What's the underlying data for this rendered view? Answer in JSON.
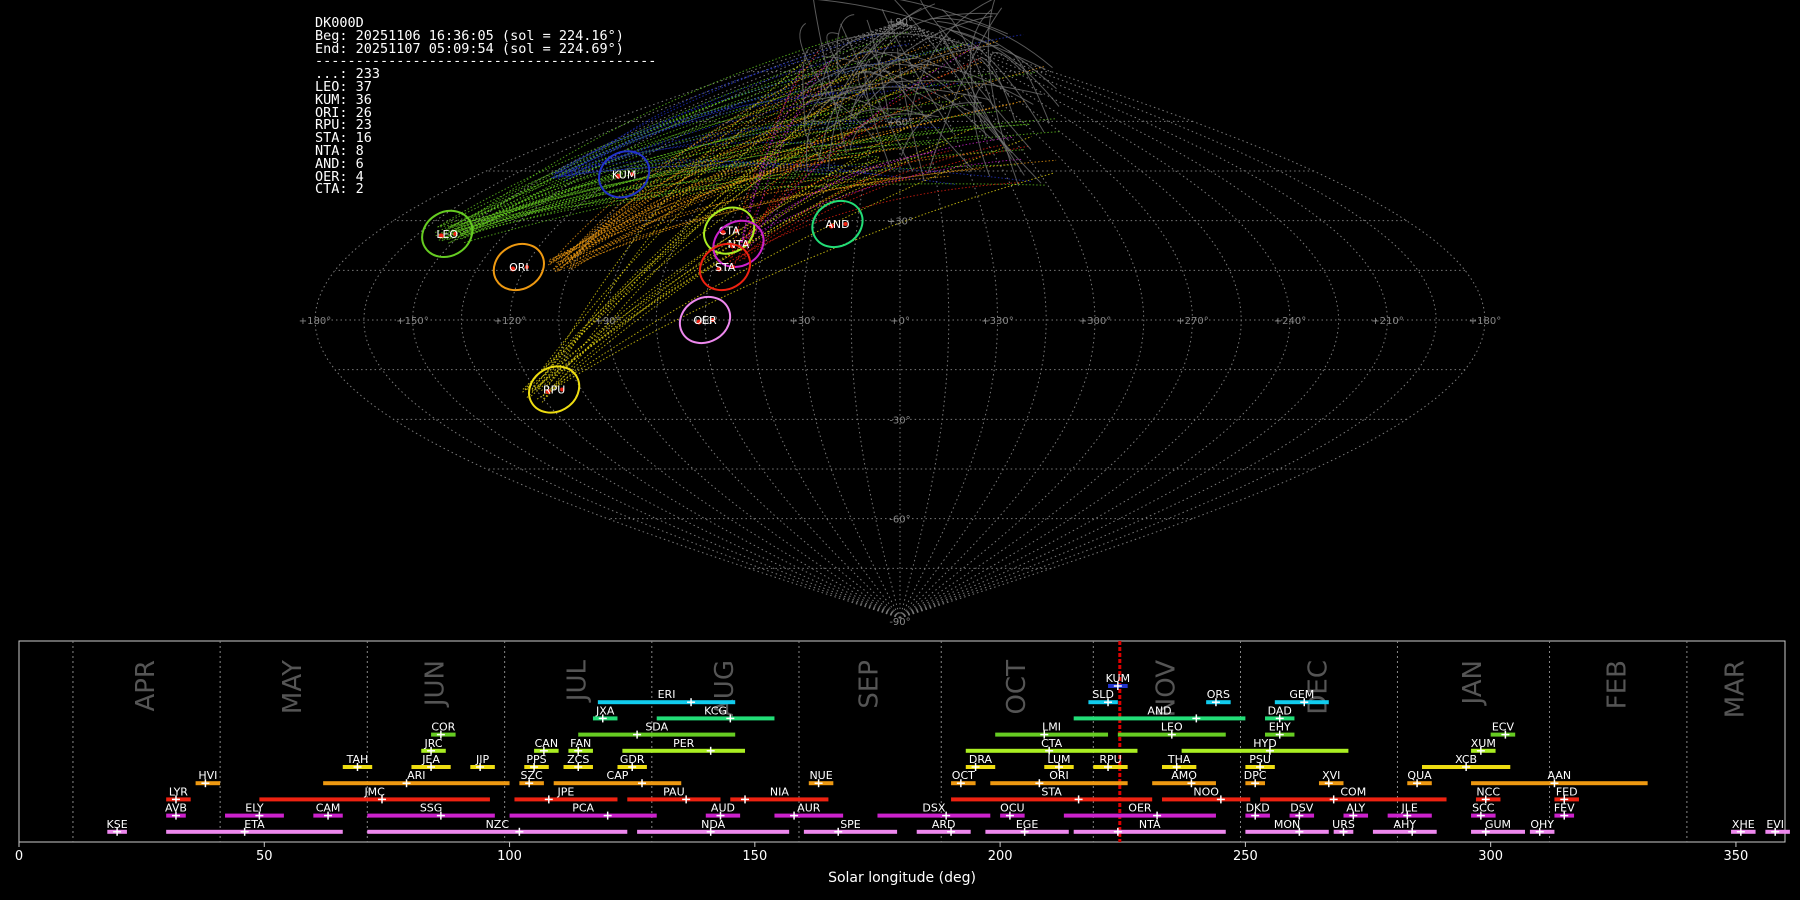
{
  "header": {
    "station": "DK000D",
    "beg": "Beg: 20251106 16:36:05 (sol = 224.16°)",
    "end": "End: 20251107 05:09:54 (sol = 224.69°)",
    "divider": "------------------------------------------"
  },
  "counts": [
    {
      "code": "...",
      "count": 233
    },
    {
      "code": "LEO",
      "count": 37
    },
    {
      "code": "KUM",
      "count": 36
    },
    {
      "code": "ORI",
      "count": 26
    },
    {
      "code": "RPU",
      "count": 23
    },
    {
      "code": "STA",
      "count": 16
    },
    {
      "code": "NTA",
      "count": 8
    },
    {
      "code": "AND",
      "count": 6
    },
    {
      "code": "OER",
      "count": 4
    },
    {
      "code": "CTA",
      "count": 2
    }
  ],
  "colors": {
    "KUM": "#2233cc",
    "LEO": "#66cc22",
    "ORI": "#ee9911",
    "RPU": "#eedd11",
    "STA": "#ee2211",
    "NTA": "#cc22cc",
    "AND": "#22dd77",
    "OER": "#ee88ee",
    "CTA": "#aaee22",
    "sporadic": "#777777"
  },
  "chart_data": [
    {
      "type": "scatter",
      "projection": "sinusoidal",
      "lon_ticks": [
        "+180°",
        "+150°",
        "+120°",
        "+90°",
        "+60°",
        "+30°",
        "+0°",
        "+330°",
        "+300°",
        "+270°",
        "+240°",
        "+210°",
        "+180°"
      ],
      "lat_ticks": [
        "+90°",
        "+60°",
        "+30°",
        "-30°",
        "-60°",
        "-90°"
      ],
      "radiants": [
        {
          "name": "KUM",
          "lon": 118,
          "lat": 44
        },
        {
          "name": "LEO",
          "lon": 155,
          "lat": 26
        },
        {
          "name": "ORI",
          "lon": 122,
          "lat": 16
        },
        {
          "name": "RPU",
          "lon": 114,
          "lat": -21
        },
        {
          "name": "CTA",
          "lon": 59,
          "lat": 27
        },
        {
          "name": "NTA",
          "lon": 54,
          "lat": 23
        },
        {
          "name": "STA",
          "lon": 56,
          "lat": 16
        },
        {
          "name": "OER",
          "lon": 60,
          "lat": 0
        },
        {
          "name": "AND",
          "lon": 22,
          "lat": 29
        }
      ]
    },
    {
      "type": "bar",
      "xlabel": "Solar longitude (deg)",
      "xlim": [
        0,
        360
      ],
      "x_ticks": [
        0,
        50,
        100,
        150,
        200,
        250,
        300,
        350
      ],
      "months": [
        {
          "label": "APR",
          "start": 11
        },
        {
          "label": "MAY",
          "start": 41
        },
        {
          "label": "JUN",
          "start": 71
        },
        {
          "label": "JUL",
          "start": 99
        },
        {
          "label": "AUG",
          "start": 129
        },
        {
          "label": "SEP",
          "start": 159
        },
        {
          "label": "OCT",
          "start": 188
        },
        {
          "label": "NOV",
          "start": 219
        },
        {
          "label": "DEC",
          "start": 249
        },
        {
          "label": "JAN",
          "start": 281
        },
        {
          "label": "FEB",
          "start": 312
        },
        {
          "label": "MAR",
          "start": 340
        }
      ],
      "current_sol": 224.4,
      "showers": [
        {
          "name": "KUM",
          "start": 222,
          "end": 226,
          "peak": 224,
          "row": 0,
          "color": "#2233cc"
        },
        {
          "name": "ERI",
          "start": 118,
          "end": 146,
          "peak": 137,
          "row": 1,
          "color": "#11ccee"
        },
        {
          "name": "SLD",
          "start": 218,
          "end": 224,
          "peak": 222,
          "row": 1,
          "color": "#11ccee"
        },
        {
          "name": "ORS",
          "start": 242,
          "end": 247,
          "peak": 244,
          "row": 1,
          "color": "#11ccee"
        },
        {
          "name": "GEM",
          "start": 256,
          "end": 267,
          "peak": 262,
          "row": 1,
          "color": "#11ccee"
        },
        {
          "name": "JXA",
          "start": 117,
          "end": 122,
          "peak": 119,
          "row": 2,
          "color": "#22dd77"
        },
        {
          "name": "KCG",
          "start": 130,
          "end": 154,
          "peak": 145,
          "row": 2,
          "color": "#22dd77"
        },
        {
          "name": "AND",
          "start": 215,
          "end": 250,
          "peak": 240,
          "row": 2,
          "color": "#22dd77"
        },
        {
          "name": "DAD",
          "start": 254,
          "end": 260,
          "peak": 257,
          "row": 2,
          "color": "#22dd77"
        },
        {
          "name": "COR",
          "start": 84,
          "end": 89,
          "peak": 86,
          "row": 3,
          "color": "#66cc22"
        },
        {
          "name": "SDA",
          "start": 114,
          "end": 146,
          "peak": 126,
          "row": 3,
          "color": "#66cc22"
        },
        {
          "name": "LMI",
          "start": 199,
          "end": 222,
          "peak": 209,
          "row": 3,
          "color": "#66cc22"
        },
        {
          "name": "LEO",
          "start": 224,
          "end": 246,
          "peak": 235,
          "row": 3,
          "color": "#66cc22"
        },
        {
          "name": "EHY",
          "start": 254,
          "end": 260,
          "peak": 257,
          "row": 3,
          "color": "#66cc22"
        },
        {
          "name": "ECV",
          "start": 300,
          "end": 305,
          "peak": 303,
          "row": 3,
          "color": "#66cc22"
        },
        {
          "name": "JRC",
          "start": 82,
          "end": 87,
          "peak": 84,
          "row": 4,
          "color": "#aaee22"
        },
        {
          "name": "CAN",
          "start": 105,
          "end": 110,
          "peak": 107,
          "row": 4,
          "color": "#aaee22"
        },
        {
          "name": "FAN",
          "start": 112,
          "end": 117,
          "peak": 114,
          "row": 4,
          "color": "#aaee22"
        },
        {
          "name": "PER",
          "start": 123,
          "end": 148,
          "peak": 141,
          "row": 4,
          "color": "#aaee22"
        },
        {
          "name": "CTA",
          "start": 193,
          "end": 228,
          "peak": 210,
          "row": 4,
          "color": "#aaee22"
        },
        {
          "name": "HYD",
          "start": 237,
          "end": 271,
          "peak": 255,
          "row": 4,
          "color": "#aaee22"
        },
        {
          "name": "XUM",
          "start": 296,
          "end": 301,
          "peak": 298,
          "row": 4,
          "color": "#aaee22"
        },
        {
          "name": "TAH",
          "start": 66,
          "end": 72,
          "peak": 69,
          "row": 5,
          "color": "#eedd11"
        },
        {
          "name": "JEA",
          "start": 80,
          "end": 88,
          "peak": 84,
          "row": 5,
          "color": "#eedd11"
        },
        {
          "name": "JIP",
          "start": 92,
          "end": 97,
          "peak": 94,
          "row": 5,
          "color": "#eedd11"
        },
        {
          "name": "PPS",
          "start": 103,
          "end": 108,
          "peak": 105,
          "row": 5,
          "color": "#eedd11"
        },
        {
          "name": "ZCS",
          "start": 111,
          "end": 117,
          "peak": 114,
          "row": 5,
          "color": "#eedd11"
        },
        {
          "name": "GDR",
          "start": 122,
          "end": 128,
          "peak": 125,
          "row": 5,
          "color": "#eedd11"
        },
        {
          "name": "DRA",
          "start": 193,
          "end": 199,
          "peak": 195,
          "row": 5,
          "color": "#eedd11"
        },
        {
          "name": "LUM",
          "start": 209,
          "end": 215,
          "peak": 212,
          "row": 5,
          "color": "#eedd11"
        },
        {
          "name": "RPU",
          "start": 219,
          "end": 226,
          "peak": 222,
          "row": 5,
          "color": "#eedd11"
        },
        {
          "name": "THA",
          "start": 233,
          "end": 240,
          "peak": 236,
          "row": 5,
          "color": "#eedd11"
        },
        {
          "name": "PSU",
          "start": 250,
          "end": 256,
          "peak": 253,
          "row": 5,
          "color": "#eedd11"
        },
        {
          "name": "XCB",
          "start": 286,
          "end": 304,
          "peak": 295,
          "row": 5,
          "color": "#eedd11"
        },
        {
          "name": "HVI",
          "start": 36,
          "end": 41,
          "peak": 38,
          "row": 6,
          "color": "#ee9911"
        },
        {
          "name": "ARI",
          "start": 62,
          "end": 100,
          "peak": 79,
          "row": 6,
          "color": "#ee9911"
        },
        {
          "name": "SZC",
          "start": 102,
          "end": 107,
          "peak": 104,
          "row": 6,
          "color": "#ee9911"
        },
        {
          "name": "CAP",
          "start": 109,
          "end": 135,
          "peak": 127,
          "row": 6,
          "color": "#ee9911"
        },
        {
          "name": "NUE",
          "start": 161,
          "end": 166,
          "peak": 163,
          "row": 6,
          "color": "#ee9911"
        },
        {
          "name": "OCT",
          "start": 190,
          "end": 195,
          "peak": 192,
          "row": 6,
          "color": "#ee9911"
        },
        {
          "name": "ORI",
          "start": 198,
          "end": 226,
          "peak": 208,
          "row": 6,
          "color": "#ee9911"
        },
        {
          "name": "AMO",
          "start": 231,
          "end": 244,
          "peak": 239,
          "row": 6,
          "color": "#ee9911"
        },
        {
          "name": "DPC",
          "start": 250,
          "end": 254,
          "peak": 252,
          "row": 6,
          "color": "#ee9911"
        },
        {
          "name": "XVI",
          "start": 265,
          "end": 270,
          "peak": 267,
          "row": 6,
          "color": "#ee9911"
        },
        {
          "name": "QUA",
          "start": 283,
          "end": 288,
          "peak": 285,
          "row": 6,
          "color": "#ee9911"
        },
        {
          "name": "AAN",
          "start": 296,
          "end": 332,
          "peak": 313,
          "row": 6,
          "color": "#ee9911"
        },
        {
          "name": "LYR",
          "start": 30,
          "end": 35,
          "peak": 32,
          "row": 7,
          "color": "#ee2211"
        },
        {
          "name": "JMC",
          "start": 49,
          "end": 96,
          "peak": 74,
          "row": 7,
          "color": "#ee2211"
        },
        {
          "name": "JPE",
          "start": 101,
          "end": 122,
          "peak": 108,
          "row": 7,
          "color": "#ee2211"
        },
        {
          "name": "PAU",
          "start": 124,
          "end": 143,
          "peak": 136,
          "row": 7,
          "color": "#ee2211"
        },
        {
          "name": "NIA",
          "start": 145,
          "end": 165,
          "peak": 148,
          "row": 7,
          "color": "#ee2211"
        },
        {
          "name": "STA",
          "start": 190,
          "end": 231,
          "peak": 216,
          "row": 7,
          "color": "#ee2211"
        },
        {
          "name": "NOO",
          "start": 233,
          "end": 251,
          "peak": 245,
          "row": 7,
          "color": "#ee2211"
        },
        {
          "name": "COM",
          "start": 253,
          "end": 291,
          "peak": 268,
          "row": 7,
          "color": "#ee2211"
        },
        {
          "name": "NCC",
          "start": 297,
          "end": 302,
          "peak": 299,
          "row": 7,
          "color": "#ee2211"
        },
        {
          "name": "FED",
          "start": 313,
          "end": 318,
          "peak": 315,
          "row": 7,
          "color": "#ee2211"
        },
        {
          "name": "AVB",
          "start": 30,
          "end": 34,
          "peak": 32,
          "row": 8,
          "color": "#cc22cc"
        },
        {
          "name": "ELY",
          "start": 42,
          "end": 54,
          "peak": 49,
          "row": 8,
          "color": "#cc22cc"
        },
        {
          "name": "CAM",
          "start": 60,
          "end": 66,
          "peak": 63,
          "row": 8,
          "color": "#cc22cc"
        },
        {
          "name": "SSG",
          "start": 71,
          "end": 97,
          "peak": 86,
          "row": 8,
          "color": "#cc22cc"
        },
        {
          "name": "PCA",
          "start": 100,
          "end": 130,
          "peak": 120,
          "row": 8,
          "color": "#cc22cc"
        },
        {
          "name": "AUD",
          "start": 140,
          "end": 147,
          "peak": 143,
          "row": 8,
          "color": "#cc22cc"
        },
        {
          "name": "AUR",
          "start": 154,
          "end": 168,
          "peak": 158,
          "row": 8,
          "color": "#cc22cc"
        },
        {
          "name": "DSX",
          "start": 175,
          "end": 198,
          "peak": 189,
          "row": 8,
          "color": "#cc22cc"
        },
        {
          "name": "OCU",
          "start": 200,
          "end": 205,
          "peak": 202,
          "row": 8,
          "color": "#cc22cc"
        },
        {
          "name": "OER",
          "start": 213,
          "end": 244,
          "peak": 232,
          "row": 8,
          "color": "#cc22cc"
        },
        {
          "name": "DKD",
          "start": 250,
          "end": 255,
          "peak": 252,
          "row": 8,
          "color": "#cc22cc"
        },
        {
          "name": "DSV",
          "start": 259,
          "end": 264,
          "peak": 261,
          "row": 8,
          "color": "#cc22cc"
        },
        {
          "name": "ALY",
          "start": 270,
          "end": 275,
          "peak": 272,
          "row": 8,
          "color": "#cc22cc"
        },
        {
          "name": "JLE",
          "start": 279,
          "end": 288,
          "peak": 283,
          "row": 8,
          "color": "#cc22cc"
        },
        {
          "name": "SCC",
          "start": 296,
          "end": 301,
          "peak": 298,
          "row": 8,
          "color": "#cc22cc"
        },
        {
          "name": "FEV",
          "start": 313,
          "end": 317,
          "peak": 315,
          "row": 8,
          "color": "#cc22cc"
        },
        {
          "name": "KSE",
          "start": 18,
          "end": 22,
          "peak": 20,
          "row": 9,
          "color": "#ee88ee"
        },
        {
          "name": "ETA",
          "start": 30,
          "end": 66,
          "peak": 46,
          "row": 9,
          "color": "#ee88ee"
        },
        {
          "name": "NZC",
          "start": 71,
          "end": 124,
          "peak": 102,
          "row": 9,
          "color": "#ee88ee"
        },
        {
          "name": "NDA",
          "start": 126,
          "end": 157,
          "peak": 141,
          "row": 9,
          "color": "#ee88ee"
        },
        {
          "name": "SPE",
          "start": 160,
          "end": 179,
          "peak": 167,
          "row": 9,
          "color": "#ee88ee"
        },
        {
          "name": "ARD",
          "start": 183,
          "end": 194,
          "peak": 190,
          "row": 9,
          "color": "#ee88ee"
        },
        {
          "name": "EGE",
          "start": 197,
          "end": 214,
          "peak": 205,
          "row": 9,
          "color": "#ee88ee"
        },
        {
          "name": "NTA",
          "start": 215,
          "end": 246,
          "peak": 224,
          "row": 9,
          "color": "#ee88ee"
        },
        {
          "name": "MON",
          "start": 250,
          "end": 267,
          "peak": 261,
          "row": 9,
          "color": "#ee88ee"
        },
        {
          "name": "URS",
          "start": 268,
          "end": 272,
          "peak": 270,
          "row": 9,
          "color": "#ee88ee"
        },
        {
          "name": "AHY",
          "start": 276,
          "end": 289,
          "peak": 284,
          "row": 9,
          "color": "#ee88ee"
        },
        {
          "name": "GUM",
          "start": 296,
          "end": 307,
          "peak": 299,
          "row": 9,
          "color": "#ee88ee"
        },
        {
          "name": "OHY",
          "start": 308,
          "end": 313,
          "peak": 310,
          "row": 9,
          "color": "#ee88ee"
        },
        {
          "name": "XHE",
          "start": 349,
          "end": 354,
          "peak": 351,
          "row": 9,
          "color": "#ee88ee"
        },
        {
          "name": "EVI",
          "start": 356,
          "end": 361,
          "peak": 358,
          "row": 9,
          "color": "#ee88ee"
        }
      ]
    }
  ]
}
